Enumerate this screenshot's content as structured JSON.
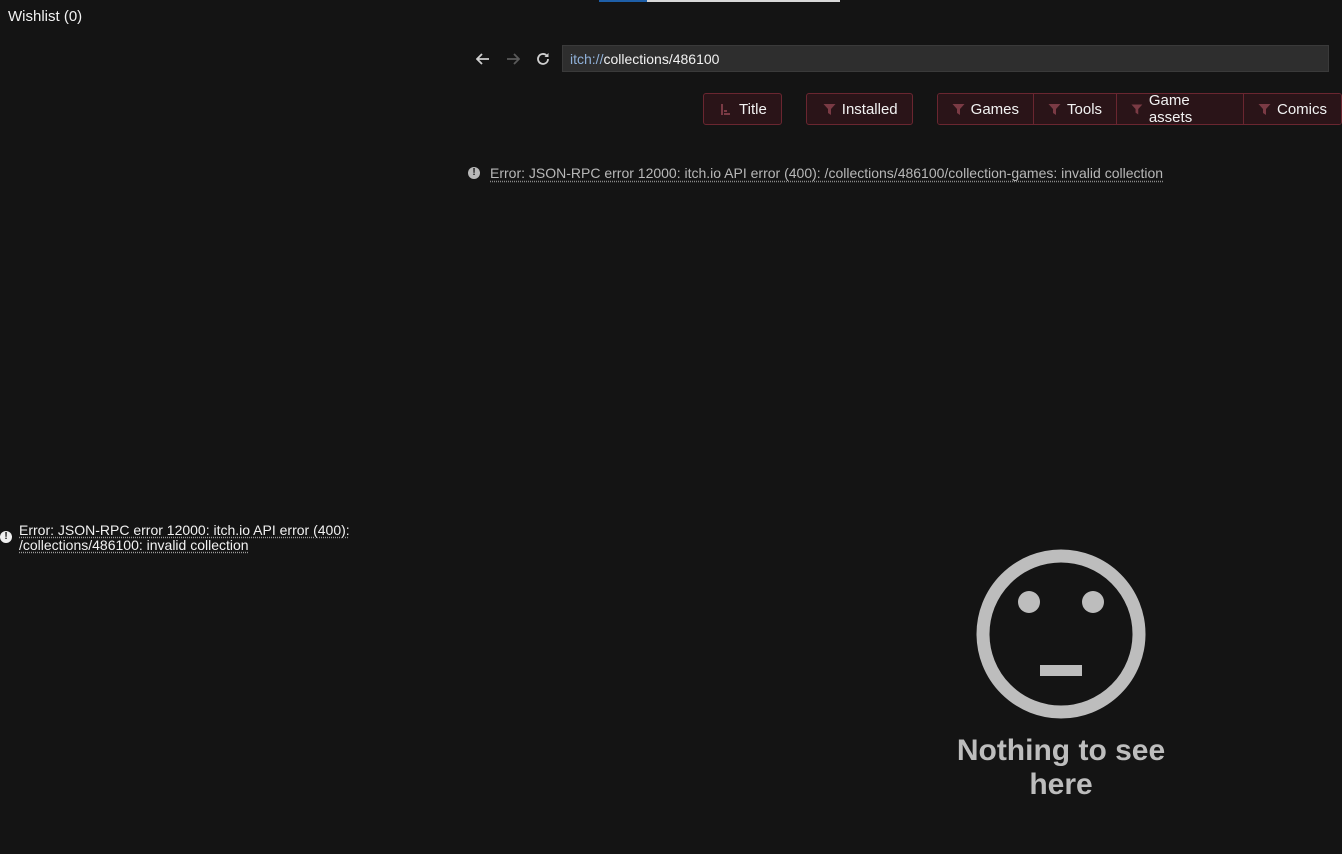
{
  "sidebar": {
    "title": "Wishlist (0)",
    "error": "Error: JSON-RPC error 12000: itch.io API error (400): /collections/486100: invalid collection"
  },
  "nav": {
    "back_icon": "arrow-left-icon",
    "forward_icon": "arrow-right-icon",
    "reload_icon": "reload-icon",
    "url_scheme": "itch://",
    "url_path": "collections/486100"
  },
  "filters": {
    "sort": {
      "label": "Title",
      "icon": "sort-icon"
    },
    "installed": {
      "label": "Installed",
      "icon": "filter-icon"
    },
    "types": [
      {
        "label": "Games",
        "icon": "filter-icon"
      },
      {
        "label": "Tools",
        "icon": "filter-icon"
      },
      {
        "label": "Game assets",
        "icon": "filter-icon"
      },
      {
        "label": "Comics",
        "icon": "filter-icon"
      }
    ]
  },
  "main": {
    "error": "Error: JSON-RPC error 12000: itch.io API error (400): /collections/486100/collection-games: invalid collection",
    "empty_text": "Nothing to see here",
    "empty_icon": "neutral-face-icon"
  },
  "colors": {
    "background": "#141414",
    "filter_bg": "#2a1418",
    "filter_border": "#6a2630",
    "url_scheme": "#8fb0d8",
    "accent": "#1e5fa8"
  }
}
